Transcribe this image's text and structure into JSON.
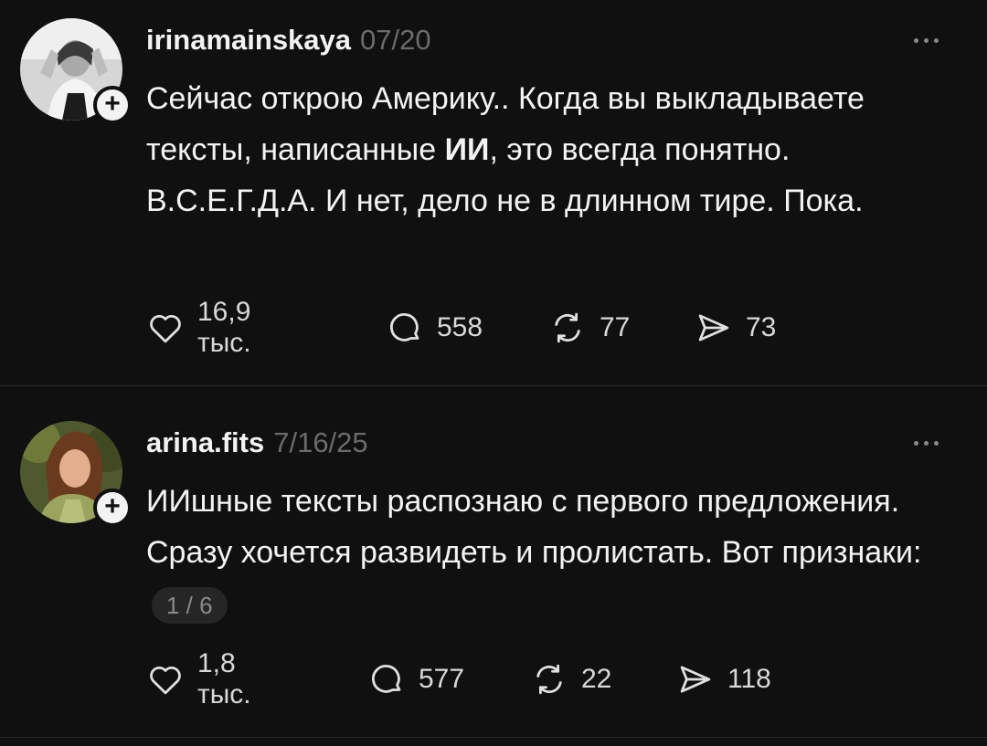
{
  "posts": [
    {
      "username": "irinamainskaya",
      "date": "07/20",
      "text_before": "Сейчас открою Америку.. Когда вы выкладываете тексты, написанные ",
      "text_bold": "ИИ",
      "text_after": ", это всегда понятно. В.С.Е.Г.Д.А. И нет, дело не в длинном тире. Пока.",
      "likes": "16,9 тыс.",
      "comments": "558",
      "reposts": "77",
      "shares": "73"
    },
    {
      "username": "arina.fits",
      "date": "7/16/25",
      "text": "ИИшные тексты распознаю с первого предложения. Сразу хочется развидеть и пролистать. Вот признаки:",
      "page_indicator": "1 / 6",
      "likes": "1,8 тыс.",
      "comments": "577",
      "reposts": "22",
      "shares": "118"
    }
  ],
  "icons": {
    "like": "heart-icon",
    "comment": "comment-bubble-icon",
    "repost": "repost-icon",
    "share": "share-send-icon",
    "more": "more-dots-icon",
    "follow": "plus-icon"
  },
  "colors": {
    "background": "#101010",
    "text": "#f3f3f3",
    "muted": "#6b6b6b"
  }
}
